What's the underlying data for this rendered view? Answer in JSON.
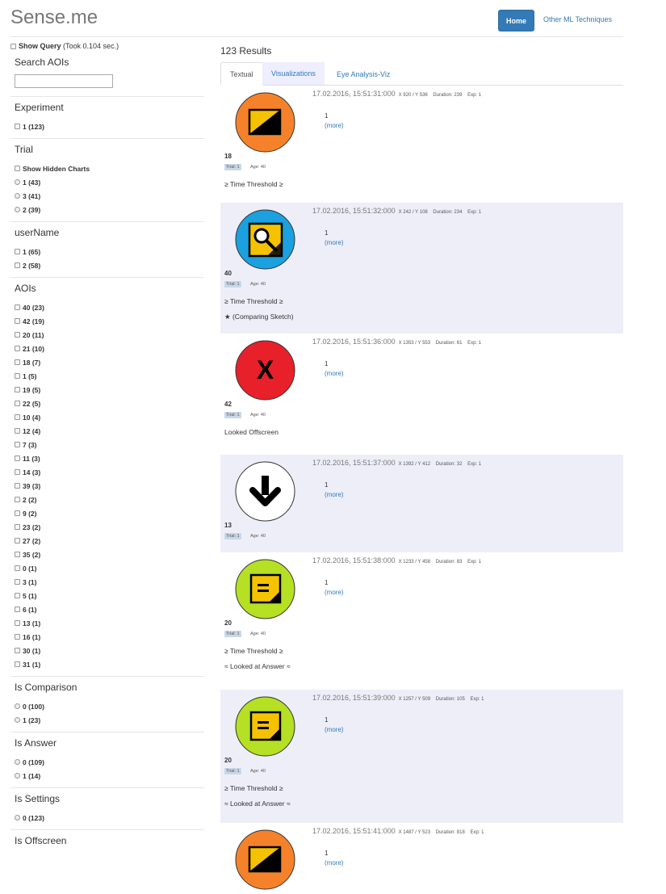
{
  "header": {
    "brand": "Sense.me",
    "nav": {
      "home": "Home",
      "other": "Other ML Techniques"
    }
  },
  "sidebar": {
    "show_query_label": "Show Query",
    "took_text": "(Took 0.104 sec.)",
    "search": {
      "title": "Search AOIs",
      "value": "",
      "placeholder": ""
    },
    "experiment": {
      "title": "Experiment",
      "items": [
        "1 (123)"
      ]
    },
    "trial": {
      "title": "Trial",
      "hidden_charts": "Show Hidden Charts",
      "items": [
        "1 (43)",
        "3 (41)",
        "2 (39)"
      ]
    },
    "username": {
      "title": "userName",
      "items": [
        "1 (65)",
        "2 (58)"
      ]
    },
    "aois": {
      "title": "AOIs",
      "items": [
        "40 (23)",
        "42 (19)",
        "20 (11)",
        "21 (10)",
        "18 (7)",
        "1 (5)",
        "19 (5)",
        "22 (5)",
        "10 (4)",
        "12 (4)",
        "7 (3)",
        "11 (3)",
        "14 (3)",
        "39 (3)",
        "2 (2)",
        "9 (2)",
        "23 (2)",
        "27 (2)",
        "35 (2)",
        "0 (1)",
        "3 (1)",
        "5 (1)",
        "6 (1)",
        "13 (1)",
        "16 (1)",
        "30 (1)",
        "31 (1)"
      ]
    },
    "is_comparison": {
      "title": "Is Comparison",
      "items": [
        "0 (100)",
        "1 (23)"
      ]
    },
    "is_answer": {
      "title": "Is Answer",
      "items": [
        "0 (109)",
        "1 (14)"
      ]
    },
    "is_settings": {
      "title": "Is Settings",
      "items": [
        "0 (123)"
      ]
    },
    "is_offscreen": {
      "title": "Is Offscreen"
    }
  },
  "main": {
    "results_count": "123 Results",
    "tabs": [
      "Textual",
      "Visualizations",
      "Eye Analysis-Viz"
    ],
    "results": [
      {
        "timestamp": "17.02.2016, 15:51:31:000",
        "meta": "X 920 / Y 536    Duration: 239    Exp: 1",
        "value": "1",
        "more": "(more)",
        "aoi": "18",
        "trial": "Trial: 1",
        "age": "Age: 40",
        "tags": [
          "≥ Time Threshold ≥"
        ],
        "icon": "orange-chart-icon",
        "color": "#f5822a"
      },
      {
        "timestamp": "17.02.2016, 15:51:32:000",
        "meta": "X 242 / Y 108    Duration: 234    Exp: 1",
        "value": "1",
        "more": "(more)",
        "aoi": "40",
        "trial": "Trial: 1",
        "age": "Age: 40",
        "tags": [
          "≥ Time Threshold ≥",
          "★ (Comparing Sketch)"
        ],
        "icon": "magnifier-icon",
        "color": "#1ba0e0"
      },
      {
        "timestamp": "17.02.2016, 15:51:36:000",
        "meta": "X 1353 / Y 553    Duration: 61    Exp: 1",
        "value": "1",
        "more": "(more)",
        "aoi": "42",
        "trial": "Trial: 1",
        "age": "Age: 40",
        "tags": [
          "Looked Offscreen"
        ],
        "icon": "x-icon",
        "color": "#e8202a"
      },
      {
        "timestamp": "17.02.2016, 15:51:37:000",
        "meta": "X 1392 / Y 412    Duration: 32    Exp: 1",
        "value": "1",
        "more": "(more)",
        "aoi": "13",
        "trial": "Trial: 1",
        "age": "Age: 40",
        "tags": [],
        "icon": "arrow-down-icon",
        "color": "#ffffff"
      },
      {
        "timestamp": "17.02.2016, 15:51:38:000",
        "meta": "X 1233 / Y 458    Duration: 83    Exp: 1",
        "value": "1",
        "more": "(more)",
        "aoi": "20",
        "trial": "Trial: 1",
        "age": "Age: 40",
        "tags": [
          "≥ Time Threshold ≥",
          "≈ Looked at Answer ≈"
        ],
        "icon": "answer-icon",
        "color": "#b5e023"
      },
      {
        "timestamp": "17.02.2016, 15:51:39:000",
        "meta": "X 1257 / Y 509    Duration: 105    Exp: 1",
        "value": "1",
        "more": "(more)",
        "aoi": "20",
        "trial": "Trial: 1",
        "age": "Age: 40",
        "tags": [
          "≥ Time Threshold ≥",
          "≈ Looked at Answer ≈"
        ],
        "icon": "answer-icon",
        "color": "#b5e023"
      },
      {
        "timestamp": "17.02.2016, 15:51:41:000",
        "meta": "X 1487 / Y 523    Duration: 818    Exp: 1",
        "value": "1",
        "more": "(more)",
        "aoi": "",
        "trial": "",
        "age": "",
        "tags": [],
        "icon": "orange-chart-icon",
        "color": "#f5822a"
      }
    ]
  }
}
